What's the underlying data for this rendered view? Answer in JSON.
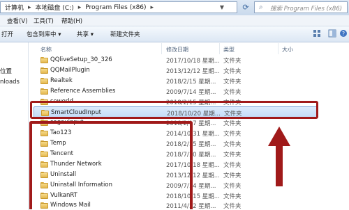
{
  "address": {
    "segments": [
      "计算机",
      "本地磁盘 (C:)",
      "Program Files (x86)"
    ],
    "search_placeholder": "搜索 Program Files (x86)"
  },
  "menu": [
    "查看(V)",
    "工具(T)",
    "帮助(H)"
  ],
  "toolbar": {
    "open": "打开",
    "include": "包含到库中 ▾",
    "share": "共享 ▾",
    "new_folder": "新建文件夹"
  },
  "nav": [
    "位置",
    "nloads"
  ],
  "columns": {
    "name": "名称",
    "date": "修改日期",
    "type": "类型",
    "size": "大小"
  },
  "files": [
    {
      "name": "QQliveSetup_30_326",
      "date": "2017/10/18 星期...",
      "type": "文件夹"
    },
    {
      "name": "QQMailPlugin",
      "date": "2013/12/12 星期...",
      "type": "文件夹"
    },
    {
      "name": "Realtek",
      "date": "2018/2/15 星期...",
      "type": "文件夹"
    },
    {
      "name": "Reference Assemblies",
      "date": "2009/7/14 星期...",
      "type": "文件夹"
    },
    {
      "name": "seworld",
      "date": "2018/2/15 星期...",
      "type": "文件夹"
    },
    {
      "name": "SmartCloudInput",
      "date": "2018/10/20 星期...",
      "type": "文件夹",
      "selected": true
    },
    {
      "name": "sogouinput",
      "date": "2018/2/17 星期...",
      "type": "文件夹"
    },
    {
      "name": "Tao123",
      "date": "2014/10/31 星期...",
      "type": "文件夹"
    },
    {
      "name": "Temp",
      "date": "2018/2/15 星期...",
      "type": "文件夹"
    },
    {
      "name": "Tencent",
      "date": "2018/7/10 星期...",
      "type": "文件夹"
    },
    {
      "name": "Thunder Network",
      "date": "2017/10/18 星期...",
      "type": "文件夹"
    },
    {
      "name": "Uninstall",
      "date": "2013/12/12 星期...",
      "type": "文件夹"
    },
    {
      "name": "Uninstall Information",
      "date": "2009/7/14 星期...",
      "type": "文件夹"
    },
    {
      "name": "VulkanRT",
      "date": "2018/10/15 星期...",
      "type": "文件夹"
    },
    {
      "name": "Windows Mail",
      "date": "2011/4/12 星期...",
      "type": "文件夹"
    }
  ],
  "colors": {
    "highlight": "#a01a1a",
    "selection": "#c2dcf7"
  }
}
